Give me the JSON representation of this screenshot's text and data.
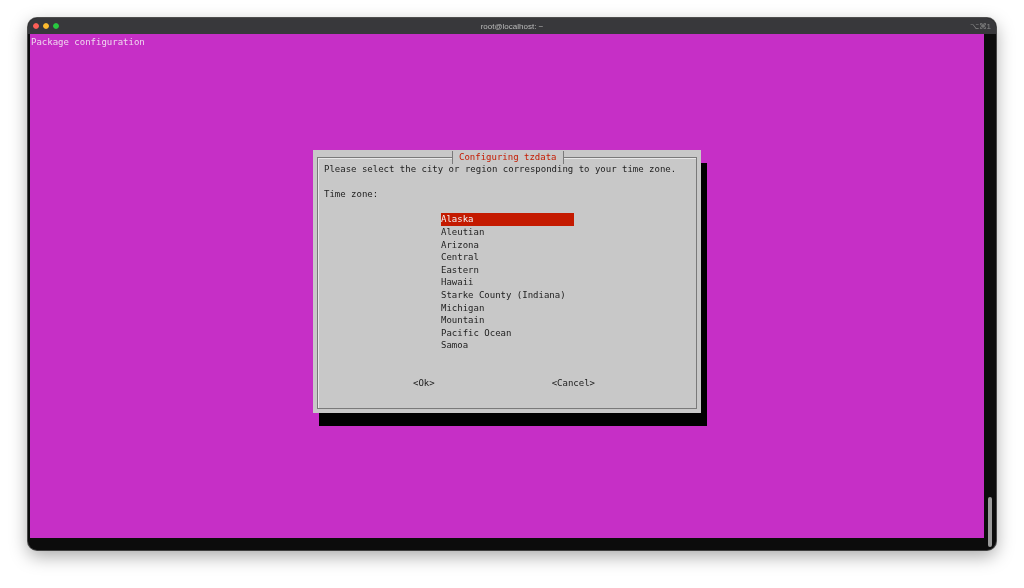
{
  "window": {
    "title": "root@localhost: ~",
    "shortcut": "⌥⌘1"
  },
  "terminal": {
    "header": "Package configuration"
  },
  "dialog": {
    "title": "Configuring tzdata",
    "prompt": "Please select the city or region corresponding to your time zone.",
    "label": "Time zone:",
    "options": [
      {
        "label": "Alaska",
        "selected": true
      },
      {
        "label": "Aleutian",
        "selected": false
      },
      {
        "label": "Arizona",
        "selected": false
      },
      {
        "label": "Central",
        "selected": false
      },
      {
        "label": "Eastern",
        "selected": false
      },
      {
        "label": "Hawaii",
        "selected": false
      },
      {
        "label": "Starke County (Indiana)",
        "selected": false
      },
      {
        "label": "Michigan",
        "selected": false
      },
      {
        "label": "Mountain",
        "selected": false
      },
      {
        "label": "Pacific Ocean",
        "selected": false
      },
      {
        "label": "Samoa",
        "selected": false
      }
    ],
    "buttons": [
      {
        "label": "<Ok>",
        "selected": false
      },
      {
        "label": "<Cancel>",
        "selected": false
      }
    ]
  }
}
